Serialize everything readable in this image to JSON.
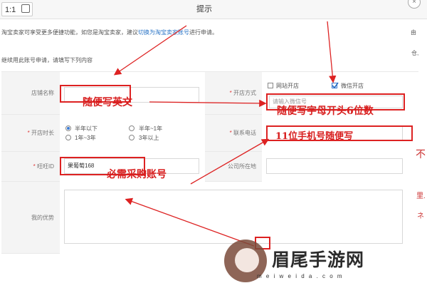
{
  "toolbar": {
    "zoom_label": "1:1"
  },
  "dialog": {
    "title": "提示",
    "close_label": "×"
  },
  "notice": {
    "prefix": "淘宝卖家可享受更多便捷功能，如您是淘宝卖家，建议",
    "link": "切换为淘宝卖家账号",
    "suffix": "进行申请。",
    "continue_text": "继续用此账号申请，请填写下列内容"
  },
  "side_fragments": {
    "f1": "由",
    "f2": "仓,",
    "f3": "不",
    "f4": "里.",
    "f5": "ネ"
  },
  "form": {
    "shop_name_label": "店铺名称",
    "shop_mode_label": "开店方式",
    "shop_mode_options": [
      "网站开店",
      "微信开店"
    ],
    "shop_mode_checked": [
      false,
      true
    ],
    "shop_mode_placeholder": "请输入微信号",
    "duration_label": "开店时长",
    "duration_options": [
      "半年以下",
      "半年~1年",
      "1年~3年",
      "3年以上"
    ],
    "duration_selected_index": 0,
    "phone_label": "联系电话",
    "wangwang_label": "旺旺ID",
    "wangwang_value": "果葡萄168",
    "location_label": "公司所在地",
    "advantage_label": "我的优势"
  },
  "annotations": {
    "a1": "随便写英文",
    "a2": "随便写字母开头6位数",
    "a3": "11位手机号随便写",
    "a4": "必需采购账号"
  },
  "watermark": {
    "title": "眉尾手游网",
    "url": "m e i w e i d a . c o m"
  },
  "colors": {
    "accent": "#2a74c6",
    "annotation": "#d22222",
    "required": "#e03a3a"
  }
}
